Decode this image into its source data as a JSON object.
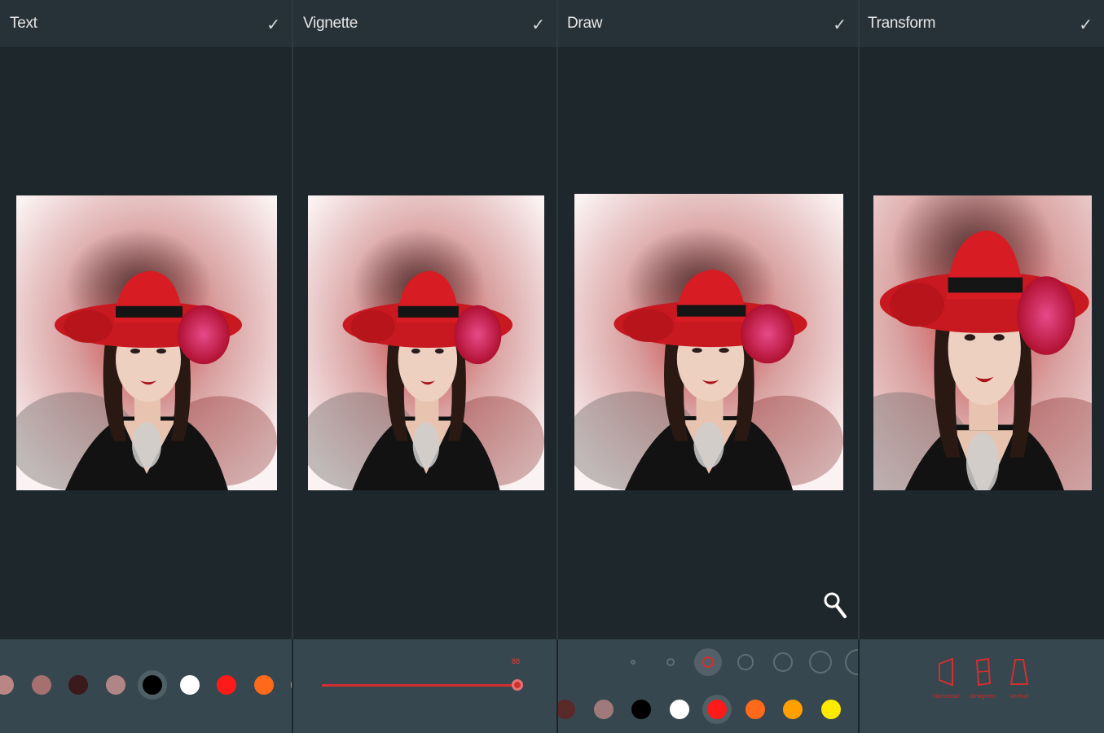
{
  "panels": [
    {
      "title": "Text",
      "confirm_icon": "check-icon"
    },
    {
      "title": "Vignette",
      "confirm_icon": "check-icon"
    },
    {
      "title": "Draw",
      "confirm_icon": "check-icon"
    },
    {
      "title": "Transform",
      "confirm_icon": "check-icon"
    }
  ],
  "colors": {
    "background": "#1e272b",
    "header": "#263238",
    "toolbar": "#37474f",
    "accent": "#d32f2f"
  },
  "text_panel": {
    "palette": [
      "#b98585",
      "#a77070",
      "#3a1a1a",
      "#b08585",
      "#000000",
      "#ffffff",
      "#ff1a1a",
      "#ff6a1a",
      "#ffa000"
    ],
    "selected_index": 4
  },
  "vignette_panel": {
    "slider_value": 1.0,
    "slider_label": "88"
  },
  "draw_panel": {
    "brush_sizes": [
      "1",
      "2",
      "3",
      "4",
      "5",
      "6",
      "7"
    ],
    "selected_brush": 2,
    "palette": [
      "#5a2a2a",
      "#a07a7a",
      "#000000",
      "#ffffff",
      "#ff1a1a",
      "#ff6a1a",
      "#ffa000",
      "#ffea00",
      "#55cc22"
    ],
    "selected_color": 4,
    "zoom_icon": "magnifier-icon"
  },
  "transform_panel": {
    "buttons": [
      {
        "label": "Horizontal",
        "icon": "perspective-horizontal-icon"
      },
      {
        "label": "Straighten",
        "icon": "straighten-icon"
      },
      {
        "label": "Vertical",
        "icon": "perspective-vertical-icon"
      }
    ]
  }
}
